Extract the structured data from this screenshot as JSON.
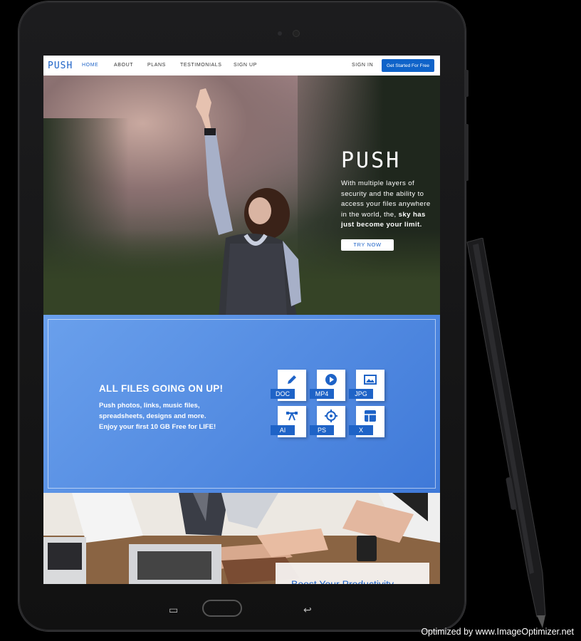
{
  "nav": {
    "logo": "PUSH",
    "links": [
      "HOME",
      "ABOUT",
      "PLANS",
      "TESTIMONIALS",
      "SIGN UP"
    ],
    "sign_in": "SIGN IN",
    "cta": "Get Started For Free"
  },
  "hero": {
    "logo": "PUSH",
    "copy_regular": "With multiple layers of security and the ability to access your files anywhere in the world, the, ",
    "copy_bold": "sky has just become your limit.",
    "button": "TRY NOW"
  },
  "files": {
    "title": "ALL FILES GOING ON UP!",
    "copy": "Push photos, links, music files, spreadsheets, designs and more. Enjoy your first 10 GB Free for LIFE!",
    "tiles": [
      {
        "label": "DOC",
        "icon": "pencil-icon"
      },
      {
        "label": "MP4",
        "icon": "play-icon"
      },
      {
        "label": "JPG",
        "icon": "image-icon"
      },
      {
        "label": "AI",
        "icon": "vector-pen-icon"
      },
      {
        "label": "PS",
        "icon": "crosshair-icon"
      },
      {
        "label": "X",
        "icon": "spreadsheet-icon"
      }
    ]
  },
  "team": {
    "caption": "Boost Your Productivity"
  },
  "colors": {
    "brand": "#1e63c7",
    "section_blue": "#4f86e0"
  },
  "watermark": "Optimized by www.ImageOptimizer.net"
}
